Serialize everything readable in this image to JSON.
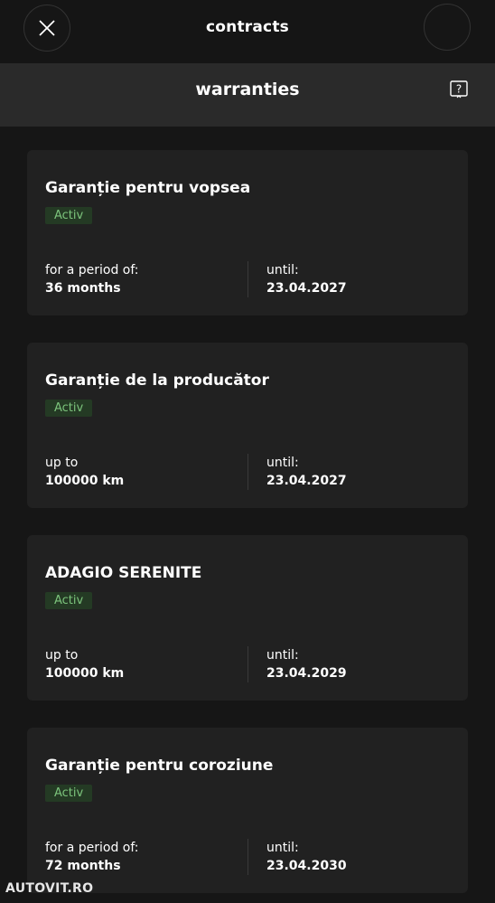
{
  "header": {
    "title": "contracts",
    "close_icon": "close-icon"
  },
  "subheader": {
    "title": "warranties",
    "help_icon": "help-icon"
  },
  "colors": {
    "background": "#151515",
    "card": "#212121",
    "badge_text": "#7cc47c",
    "badge_bg": "#243a24"
  },
  "warranties": [
    {
      "title": "Garanție pentru vopsea",
      "status": "Activ",
      "left_label": "for a period of:",
      "left_value": "36 months",
      "right_label": "until:",
      "right_value": "23.04.2027"
    },
    {
      "title": "Garanție de la producător",
      "status": "Activ",
      "left_label": "up to",
      "left_value": "100000 km",
      "right_label": "until:",
      "right_value": "23.04.2027"
    },
    {
      "title": "ADAGIO SERENITE",
      "status": "Activ",
      "left_label": "up to",
      "left_value": "100000 km",
      "right_label": "until:",
      "right_value": "23.04.2029"
    },
    {
      "title": "Garanție pentru coroziune",
      "status": "Activ",
      "left_label": "for a period of:",
      "left_value": "72 months",
      "right_label": "until:",
      "right_value": "23.04.2030"
    }
  ],
  "watermark": "AUTOVIT.RO"
}
